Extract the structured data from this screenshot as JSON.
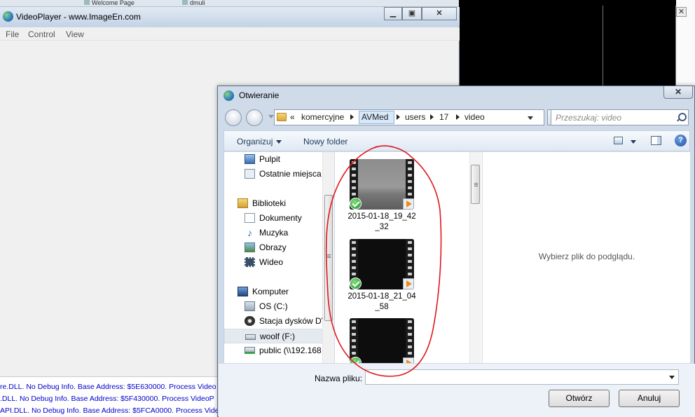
{
  "background": {
    "tabs": [
      "Welcome Page",
      "dmuli"
    ]
  },
  "video_player": {
    "title": "VideoPlayer - www.ImageEn.com",
    "menu": [
      "File",
      "Control",
      "View"
    ],
    "log_lines": [
      "re.DLL. No Debug Info. Base Address: $5E630000. Process Video",
      ".DLL. No Debug Info. Base Address: $5F430000. Process VideoP",
      "API.DLL. No Debug Info. Base Address: $5FCA0000. Process Video"
    ]
  },
  "dialog": {
    "title": "Otwieranie",
    "close_label": "✕",
    "breadcrumb": {
      "overflow": "«",
      "parts": [
        "komercyjne",
        "AVMed",
        "users",
        "17",
        "video"
      ]
    },
    "search_placeholder": "Przeszukaj: video",
    "toolbar": {
      "organize": "Organizuj",
      "new_folder": "Nowy folder"
    },
    "nav": {
      "items": [
        {
          "label": "Pulpit",
          "icon": "desktop-icon",
          "level": 1
        },
        {
          "label": "Ostatnie miejsca",
          "icon": "recent-places-icon",
          "level": 1
        },
        {
          "label": "Biblioteki",
          "icon": "libraries-icon",
          "level": 0
        },
        {
          "label": "Dokumenty",
          "icon": "documents-icon",
          "level": 1
        },
        {
          "label": "Muzyka",
          "icon": "music-icon",
          "level": 1
        },
        {
          "label": "Obrazy",
          "icon": "pictures-icon",
          "level": 1
        },
        {
          "label": "Wideo",
          "icon": "video-icon",
          "level": 1
        },
        {
          "label": "Komputer",
          "icon": "computer-icon",
          "level": 0
        },
        {
          "label": "OS (C:)",
          "icon": "drive-c-icon",
          "level": 1
        },
        {
          "label": "Stacja dysków DV",
          "icon": "dvd-drive-icon",
          "level": 1
        },
        {
          "label": "woolf (F:)",
          "icon": "removable-drive-icon",
          "level": 1,
          "selected": true
        },
        {
          "label": "public (\\\\192.168",
          "icon": "network-drive-icon",
          "level": 1
        }
      ]
    },
    "files": [
      {
        "name_line1": "2015-01-18_19_42",
        "name_line2": "_32",
        "thumbnail": "foggy-road"
      },
      {
        "name_line1": "2015-01-18_21_04",
        "name_line2": "_58",
        "thumbnail": "black"
      },
      {
        "name_line1": "",
        "name_line2": "",
        "thumbnail": "black"
      }
    ],
    "preview_text": "Wybierz plik do podglądu.",
    "filename_label": "Nazwa pliku:",
    "filename_value": "",
    "open_button": "Otwórz",
    "cancel_button": "Anuluj"
  },
  "colors": {
    "annotation": "#e0151b",
    "log_text": "#0000cc",
    "dialog_frame": "#cfdbe9"
  }
}
